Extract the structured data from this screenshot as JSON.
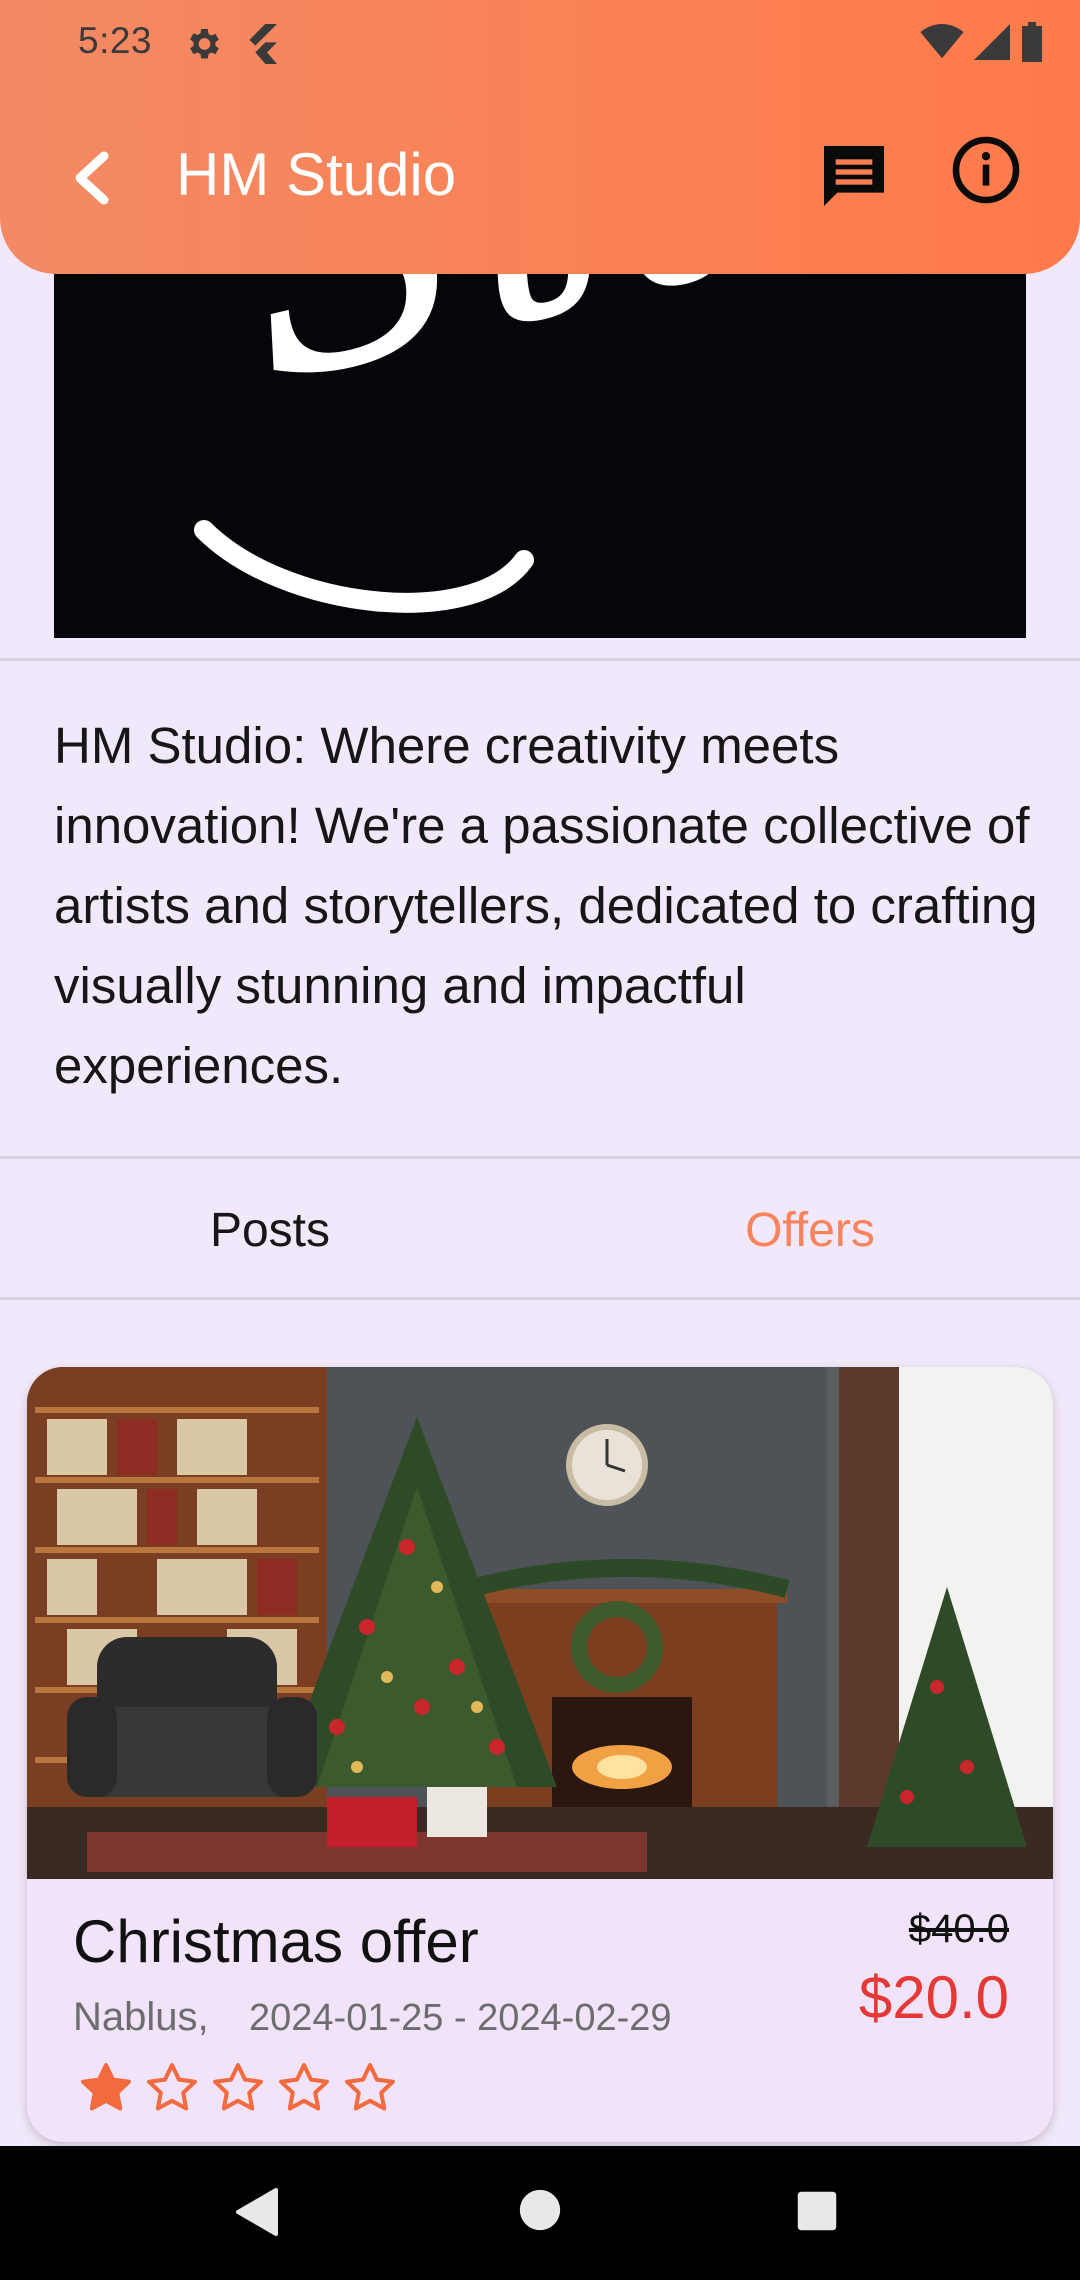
{
  "status_bar": {
    "time": "5:23",
    "icons": [
      "settings-gear-icon",
      "flutter-icon",
      "wifi-icon",
      "signal-icon",
      "battery-icon"
    ]
  },
  "app_bar": {
    "title": "HM Studio",
    "back_icon": "chevron-left-icon",
    "actions": [
      "chat-icon",
      "info-icon"
    ],
    "background": "#FF7A4A"
  },
  "banner": {
    "logo_text": "Studio",
    "background": "#05060A"
  },
  "description": "HM Studio: Where creativity meets innovation! We're a passionate collective of artists and storytellers, dedicated to crafting visually stunning and impactful experiences.",
  "tabs": [
    {
      "label": "Posts",
      "selected": false
    },
    {
      "label": "Offers",
      "selected": true
    }
  ],
  "offer": {
    "title": "Christmas offer",
    "location": "Nablus,",
    "dates": "2024-01-25 - 2024-02-29",
    "old_price": "$40.0",
    "new_price": "$20.0",
    "rating": 1,
    "max_rating": 5
  },
  "colors": {
    "accent": "#F9835A",
    "price_red": "#E53935",
    "star": "#F36A3E",
    "page_bg": "#F2E8FB"
  },
  "nav_bar": {
    "icons": [
      "back-triangle-icon",
      "home-circle-icon",
      "recents-square-icon"
    ]
  }
}
